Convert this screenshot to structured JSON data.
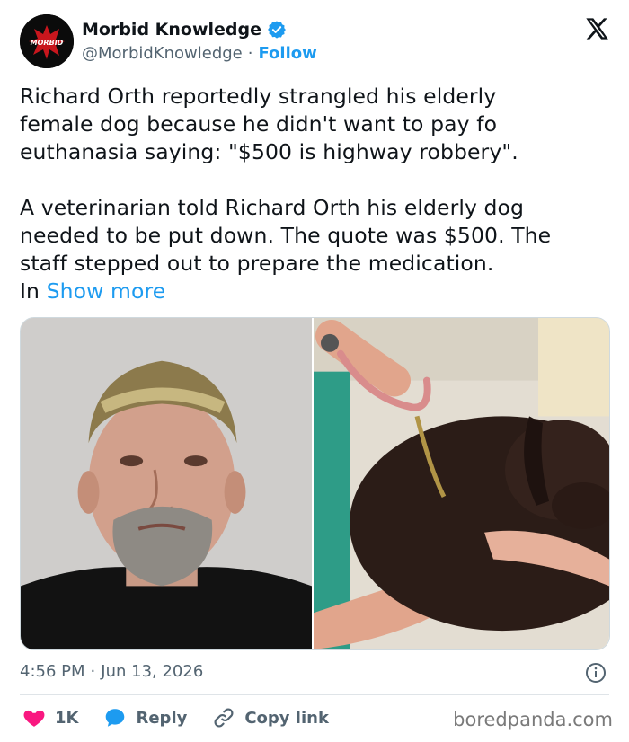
{
  "author": {
    "name": "Morbid Knowledge",
    "handle": "@MorbidKnowledge",
    "separator": "·",
    "follow_label": "Follow",
    "avatar_text": "MORBID"
  },
  "tweet": {
    "paragraphs": [
      [
        "Richard Orth reportedly strangled his elderly",
        "female dog because he didn't want to pay fo",
        "euthanasia saying: \"$500 is highway robbery\"."
      ],
      [
        "A veterinarian told Richard Orth his elderly dog",
        "needed to be put down. The quote was $500. The",
        "staff stepped out to prepare the medication."
      ]
    ],
    "truncated_start": "In ",
    "show_more_label": "Show more"
  },
  "meta": {
    "time": "4:56 PM",
    "separator": "·",
    "date": "Jun 13, 2026"
  },
  "actions": {
    "like_count": "1K",
    "reply_label": "Reply",
    "copy_link_label": "Copy link"
  },
  "watermark": "boredpanda.com",
  "colors": {
    "accent": "#1d9bf0",
    "like": "#f91880",
    "secondary_text": "#536471"
  },
  "icons": [
    "verified-badge-icon",
    "x-logo-icon",
    "info-icon",
    "heart-icon",
    "reply-bubble-icon",
    "link-icon"
  ]
}
